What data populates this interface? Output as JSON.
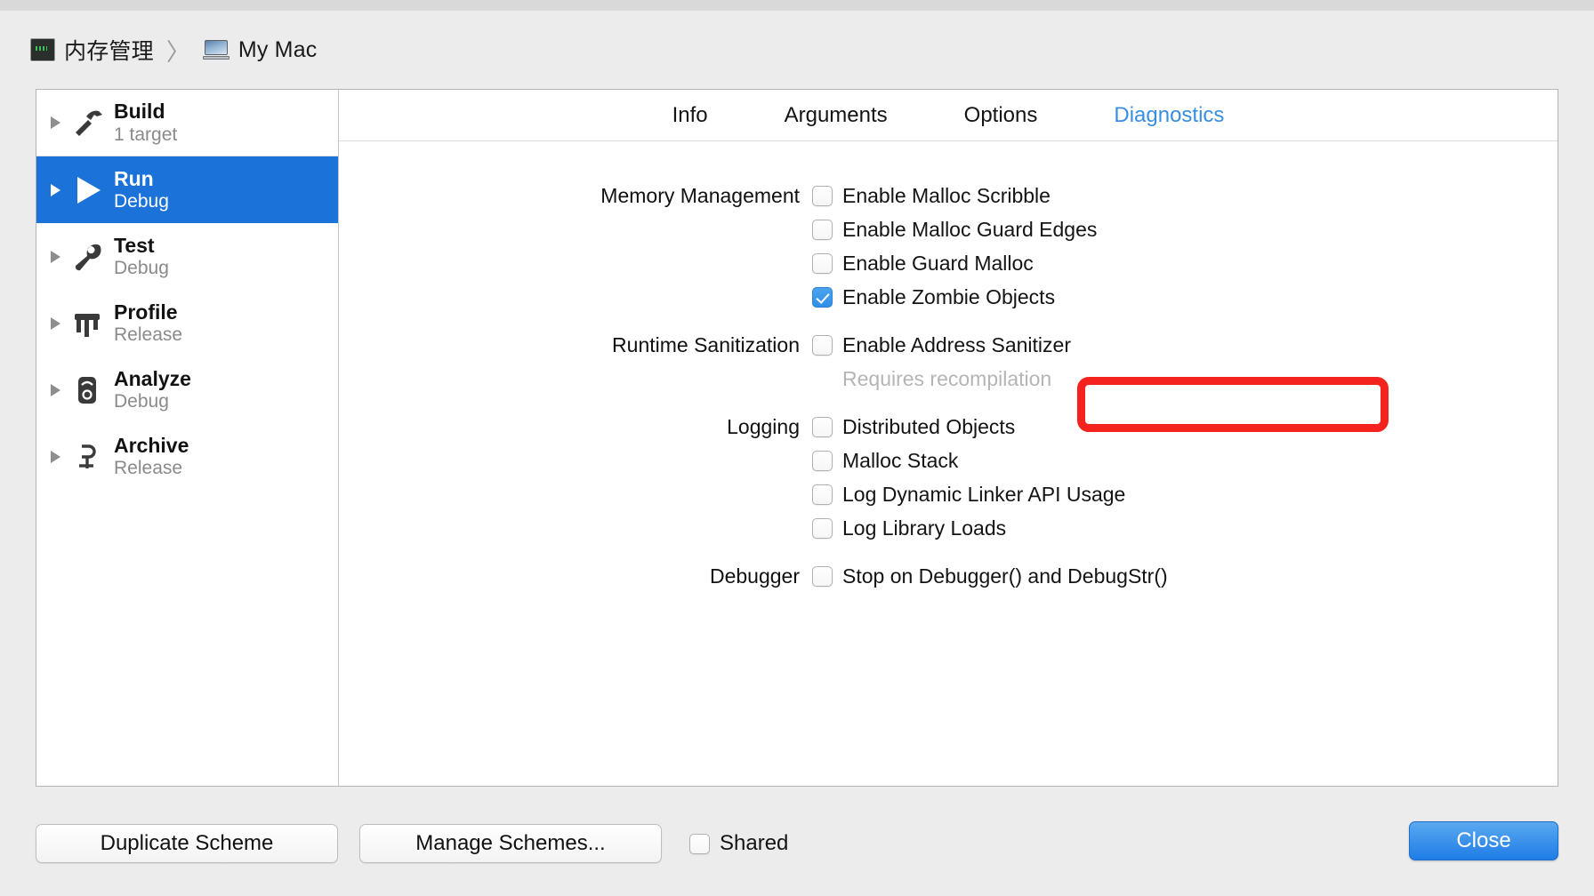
{
  "breadcrumb": {
    "scheme_icon": "scheme-icon",
    "scheme_name": "内存管理",
    "separator": "〉",
    "destination_icon": "macbook-icon",
    "destination_name": "My Mac"
  },
  "sidebar": {
    "items": [
      {
        "title": "Build",
        "sub": "1 target",
        "icon": "hammer-icon",
        "selected": false
      },
      {
        "title": "Run",
        "sub": "Debug",
        "icon": "play-icon",
        "selected": true
      },
      {
        "title": "Test",
        "sub": "Debug",
        "icon": "wrench-icon",
        "selected": false
      },
      {
        "title": "Profile",
        "sub": "Release",
        "icon": "gauge-icon",
        "selected": false
      },
      {
        "title": "Analyze",
        "sub": "Debug",
        "icon": "stethoscope-icon",
        "selected": false
      },
      {
        "title": "Archive",
        "sub": "Release",
        "icon": "clamp-icon",
        "selected": false
      }
    ]
  },
  "tabs": [
    {
      "label": "Info",
      "active": false
    },
    {
      "label": "Arguments",
      "active": false
    },
    {
      "label": "Options",
      "active": false
    },
    {
      "label": "Diagnostics",
      "active": true
    }
  ],
  "diagnostics": {
    "groups": [
      {
        "label": "Memory Management",
        "items": [
          {
            "label": "Enable Malloc Scribble",
            "checked": false
          },
          {
            "label": "Enable Malloc Guard Edges",
            "checked": false
          },
          {
            "label": "Enable Guard Malloc",
            "checked": false
          },
          {
            "label": "Enable Zombie Objects",
            "checked": true
          }
        ]
      },
      {
        "label": "Runtime Sanitization",
        "items": [
          {
            "label": "Enable Address Sanitizer",
            "checked": false
          }
        ],
        "note": "Requires recompilation"
      },
      {
        "label": "Logging",
        "items": [
          {
            "label": "Distributed Objects",
            "checked": false
          },
          {
            "label": "Malloc Stack",
            "checked": false
          },
          {
            "label": "Log Dynamic Linker API Usage",
            "checked": false
          },
          {
            "label": "Log Library Loads",
            "checked": false
          }
        ]
      },
      {
        "label": "Debugger",
        "items": [
          {
            "label": "Stop on Debugger() and DebugStr()",
            "checked": false
          }
        ]
      }
    ],
    "highlight": {
      "target_label": "Enable Zombie Objects",
      "color": "#f5231d"
    }
  },
  "bottom_bar": {
    "duplicate_label": "Duplicate Scheme",
    "manage_label": "Manage Schemes...",
    "shared_label": "Shared",
    "shared_checked": false,
    "close_label": "Close"
  },
  "colors": {
    "accent_blue": "#1b72d8",
    "tab_active": "#3a8ee0",
    "highlight_red": "#f5231d",
    "window_bg": "#ececec"
  }
}
